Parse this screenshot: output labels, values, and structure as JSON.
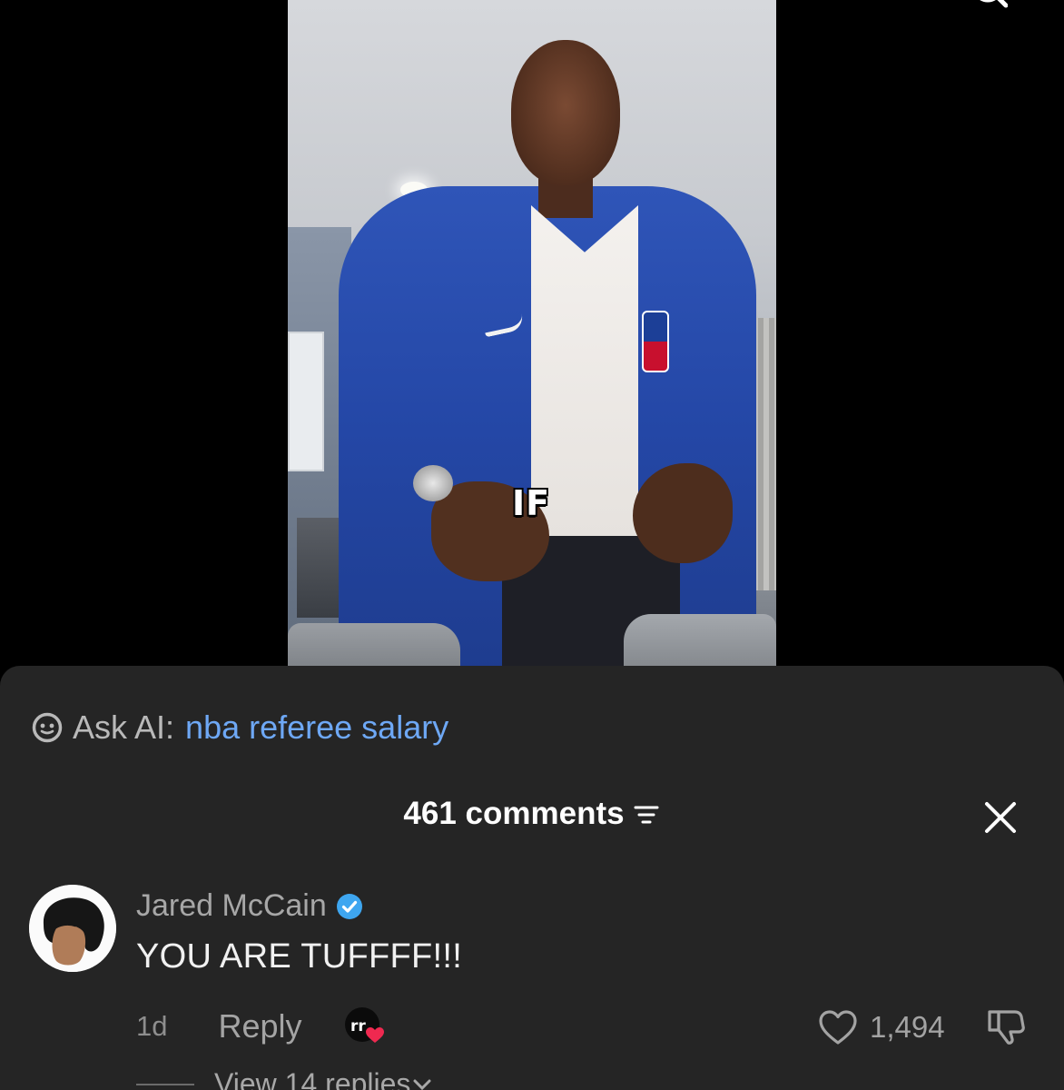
{
  "video": {
    "caption": "IF"
  },
  "ask_ai": {
    "label": "Ask AI:",
    "query": "nba referee salary"
  },
  "comments": {
    "count_label": "461 comments"
  },
  "comment": {
    "author": "Jared McCain",
    "verified": true,
    "text": "YOU ARE TUFFFF!!!",
    "time": "1d",
    "reply_label": "Reply",
    "likes": "1,494",
    "view_replies": "View 14 replies"
  },
  "colors": {
    "sheet_bg": "#252525",
    "ask_query": "#6ea8f5",
    "verified": "#3ea6f0",
    "heart": "#ef2950"
  },
  "icons": [
    "search-icon",
    "ai-face-icon",
    "sort-icon",
    "close-icon",
    "verified-icon",
    "creator-liked-icon",
    "heart-icon",
    "dislike-icon",
    "chevron-down-icon"
  ]
}
